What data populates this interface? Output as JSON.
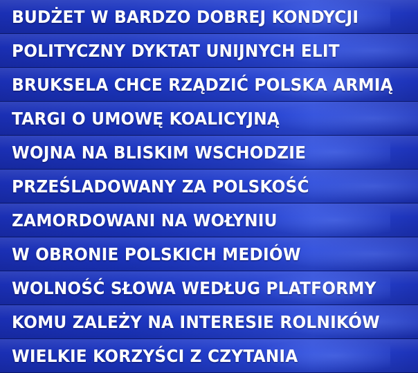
{
  "headlines": [
    "BUDŻET W BARDZO DOBREJ KONDYCJI",
    "POLITYCZNY DYKTAT UNIJNYCH ELIT",
    "BRUKSELA CHCE RZĄDZIĆ POLSKA ARMIĄ",
    "TARGI O UMOWĘ KOALICYJNĄ",
    "WOJNA NA BLISKIM WSCHODZIE",
    "PRZEŚLADOWANY ZA POLSKOŚĆ",
    "ZAMORDOWANI NA WOŁYNIU",
    "W OBRONIE POLSKICH MEDIÓW",
    "WOLNOŚĆ SŁOWA WEDŁUG PLATFORMY",
    "KOMU ZALEŻY NA INTERESIE ROLNIKÓW",
    "WIELKIE KORZYŚCI Z CZYTANIA"
  ],
  "colors": {
    "banner_blue": "#1b35c0",
    "text": "#ffffff"
  }
}
